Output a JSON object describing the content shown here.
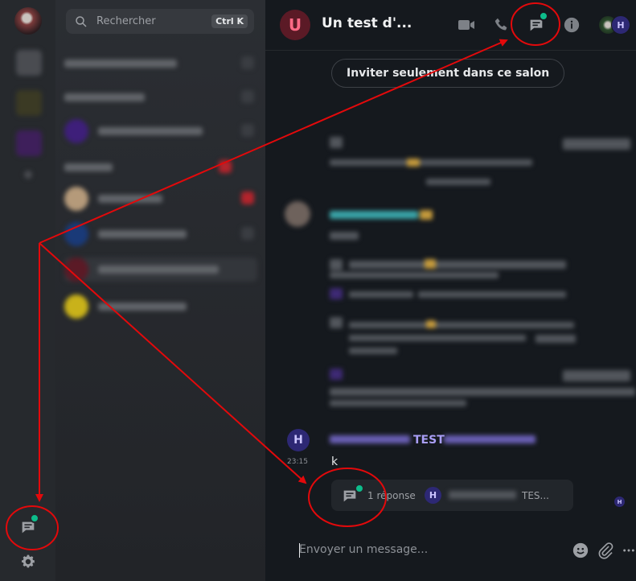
{
  "search": {
    "placeholder": "Rechercher",
    "shortcut": "Ctrl K"
  },
  "room": {
    "avatar_letter": "U",
    "title": "Un test d'..."
  },
  "header": {
    "member_avatar_letter": "H"
  },
  "timeline": {
    "invite_label": "Inviter seulement dans ce salon"
  },
  "message": {
    "avatar_letter": "H",
    "sender": "TEST",
    "timestamp": "23:15",
    "body": "k",
    "thread": {
      "replies": "1 réponse",
      "avatar_letter": "H",
      "preview": "TES..."
    },
    "read_receipt_letter": "H"
  },
  "composer": {
    "placeholder": "Envoyer un message..."
  },
  "colors": {
    "annotation": "#e3090b",
    "unread_dot": "#0dbd8b",
    "accent_user": "#a99ef6"
  },
  "icons": [
    "search-icon",
    "video-call-icon",
    "voice-call-icon",
    "threads-icon",
    "room-info-icon",
    "emoji-icon",
    "attachment-icon",
    "more-options-icon",
    "settings-gear-icon"
  ]
}
